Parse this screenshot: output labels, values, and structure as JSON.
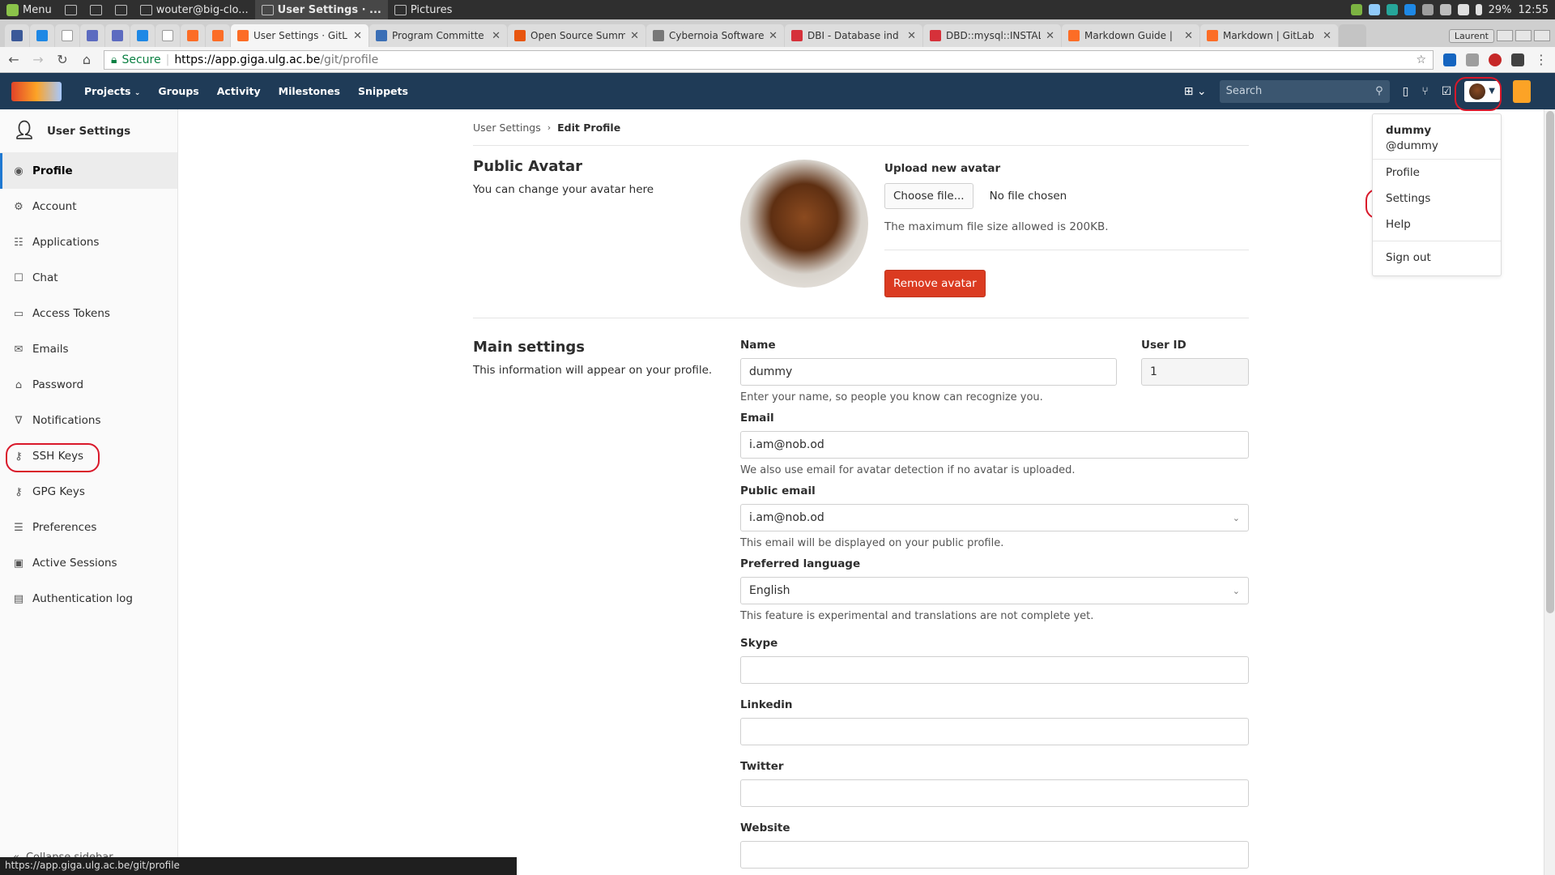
{
  "os_panel": {
    "menu_label": "Menu",
    "windows": [
      {
        "label": "wouter@big-clo...",
        "active": false
      },
      {
        "label": "User Settings · ...",
        "active": true
      },
      {
        "label": "Pictures",
        "active": false
      }
    ],
    "battery": "29%",
    "clock": "12:55"
  },
  "browser": {
    "tabs": [
      {
        "title": "User Settings · GitL",
        "active": true,
        "color": "#fc6d26"
      },
      {
        "title": "Program Committe",
        "active": false,
        "color": "#3b6fb6"
      },
      {
        "title": "Open Source Summ",
        "active": false,
        "color": "#e8550e"
      },
      {
        "title": "Cybernoia Software",
        "active": false,
        "color": "#777777"
      },
      {
        "title": "DBI - Database ind",
        "active": false,
        "color": "#d6313a"
      },
      {
        "title": "DBD::mysql::INSTAL",
        "active": false,
        "color": "#d6313a"
      },
      {
        "title": "Markdown Guide |",
        "active": false,
        "color": "#fc6d26"
      },
      {
        "title": "Markdown | GitLab",
        "active": false,
        "color": "#fc6d26"
      }
    ],
    "profile_chip": "Laurent",
    "secure_label": "Secure",
    "url_host": "https://app.giga.ulg.ac.be",
    "url_path": "/git/profile",
    "status_url": "https://app.giga.ulg.ac.be/git/profile"
  },
  "header": {
    "nav": [
      "Projects",
      "Groups",
      "Activity",
      "Milestones",
      "Snippets"
    ],
    "search_placeholder": "Search"
  },
  "sidebar": {
    "title": "User Settings",
    "items": [
      {
        "label": "Profile",
        "icon": "profile-icon",
        "glyph": "◉",
        "active": true
      },
      {
        "label": "Account",
        "icon": "account-icon",
        "glyph": "⚙",
        "active": false
      },
      {
        "label": "Applications",
        "icon": "applications-icon",
        "glyph": "☷",
        "active": false
      },
      {
        "label": "Chat",
        "icon": "chat-icon",
        "glyph": "☐",
        "active": false
      },
      {
        "label": "Access Tokens",
        "icon": "access-tokens-icon",
        "glyph": "▭",
        "active": false
      },
      {
        "label": "Emails",
        "icon": "emails-icon",
        "glyph": "✉",
        "active": false
      },
      {
        "label": "Password",
        "icon": "lock-icon",
        "glyph": "⌂",
        "active": false
      },
      {
        "label": "Notifications",
        "icon": "bell-icon",
        "glyph": "∇",
        "active": false
      },
      {
        "label": "SSH Keys",
        "icon": "key-icon",
        "glyph": "⚷",
        "active": false
      },
      {
        "label": "GPG Keys",
        "icon": "key-icon",
        "glyph": "⚷",
        "active": false
      },
      {
        "label": "Preferences",
        "icon": "sliders-icon",
        "glyph": "☰",
        "active": false
      },
      {
        "label": "Active Sessions",
        "icon": "monitor-icon",
        "glyph": "▣",
        "active": false
      },
      {
        "label": "Authentication log",
        "icon": "log-icon",
        "glyph": "▤",
        "active": false
      }
    ],
    "collapse_label": "Collapse sidebar"
  },
  "breadcrumb": {
    "parent": "User Settings",
    "current": "Edit Profile"
  },
  "avatar_section": {
    "title": "Public Avatar",
    "description": "You can change your avatar here",
    "upload_label": "Upload new avatar",
    "choose_button": "Choose file...",
    "no_file": "No file chosen",
    "max_size_hint": "The maximum file size allowed is 200KB.",
    "remove_button": "Remove avatar"
  },
  "main_settings": {
    "title": "Main settings",
    "description": "This information will appear on your profile.",
    "name_label": "Name",
    "name_value": "dummy",
    "name_help": "Enter your name, so people you know can recognize you.",
    "user_id_label": "User ID",
    "user_id_value": "1",
    "email_label": "Email",
    "email_value": "i.am@nob.od",
    "email_help": "We also use email for avatar detection if no avatar is uploaded.",
    "public_email_label": "Public email",
    "public_email_value": "i.am@nob.od",
    "public_email_help": "This email will be displayed on your public profile.",
    "language_label": "Preferred language",
    "language_value": "English",
    "language_help": "This feature is experimental and translations are not complete yet.",
    "skype_label": "Skype",
    "linkedin_label": "Linkedin",
    "twitter_label": "Twitter",
    "website_label": "Website"
  },
  "user_menu": {
    "name": "dummy",
    "handle": "@dummy",
    "items": [
      "Profile",
      "Settings",
      "Help"
    ],
    "sign_out": "Sign out"
  },
  "colors": {
    "header_bg": "#1f3b57",
    "danger": "#db3b21",
    "highlight_ring": "#d9182a",
    "active_border": "#1f78d1"
  }
}
